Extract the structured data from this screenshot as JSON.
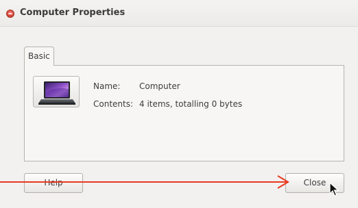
{
  "window": {
    "title": "Computer Properties"
  },
  "tabs": [
    {
      "label": "Basic",
      "selected": true
    }
  ],
  "properties": {
    "icon": "laptop-icon",
    "name_label": "Name:",
    "name_value": "Computer",
    "contents_label": "Contents:",
    "contents_value": "4 items, totalling 0 bytes"
  },
  "buttons": {
    "help_label": "Help",
    "close_label": "Close"
  },
  "colors": {
    "annotation_arrow": "#e8391f",
    "close_dot": "#d6463a"
  }
}
